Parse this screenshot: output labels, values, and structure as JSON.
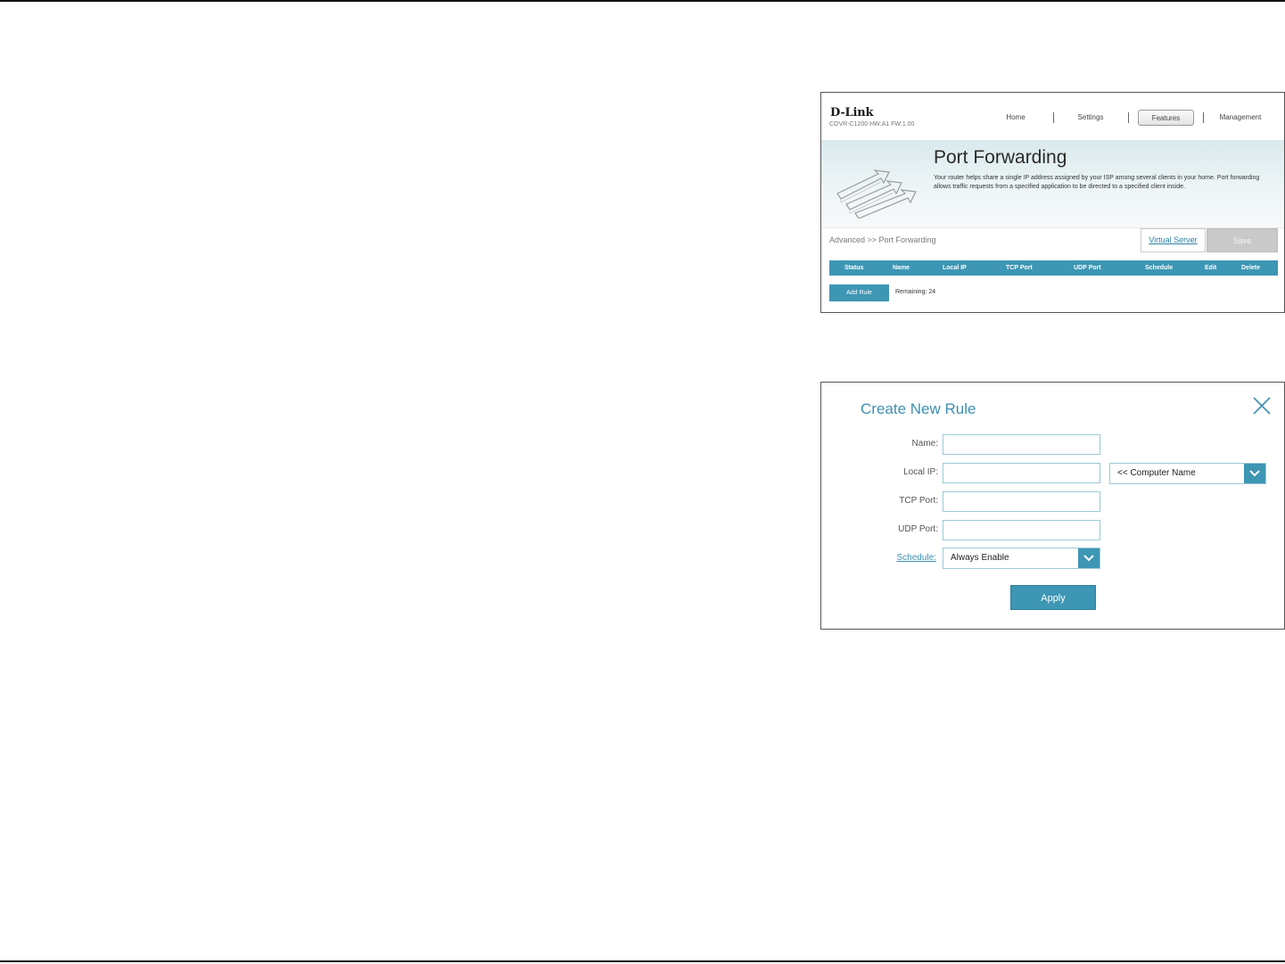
{
  "brand": {
    "logo": "D-Link",
    "model": "COVR-C1200 HW:A1 FW:1.00"
  },
  "nav": {
    "items": [
      "Home",
      "Settings",
      "Features",
      "Management"
    ],
    "active": "Features"
  },
  "port_forwarding": {
    "title": "Port Forwarding",
    "description": "Your router helps share a single IP address assigned by your ISP among several clients in your home. Port forwarding allows traffic requests from a specified application to be directed to a specified client inside.",
    "breadcrumb": "Advanced >> Port Forwarding",
    "virtual_server_link": "Virtual Server",
    "save_label": "Save",
    "table_headers": [
      "Status",
      "Name",
      "Local IP",
      "TCP Port",
      "UDP Port",
      "Schedule",
      "Edit",
      "Delete"
    ],
    "add_rule_label": "Add Rule",
    "remaining": "Remaining: 24"
  },
  "create_rule": {
    "title": "Create New Rule",
    "labels": {
      "name": "Name:",
      "local_ip": "Local IP:",
      "tcp_port": "TCP Port:",
      "udp_port": "UDP Port:",
      "schedule": "Schedule:"
    },
    "computer_name_select": "<< Computer Name",
    "schedule_select": "Always Enable",
    "apply_label": "Apply"
  },
  "colors": {
    "accent": "#3d96b4",
    "title_blue": "#3f8fb1",
    "disabled_gray": "#c9c9c9"
  }
}
